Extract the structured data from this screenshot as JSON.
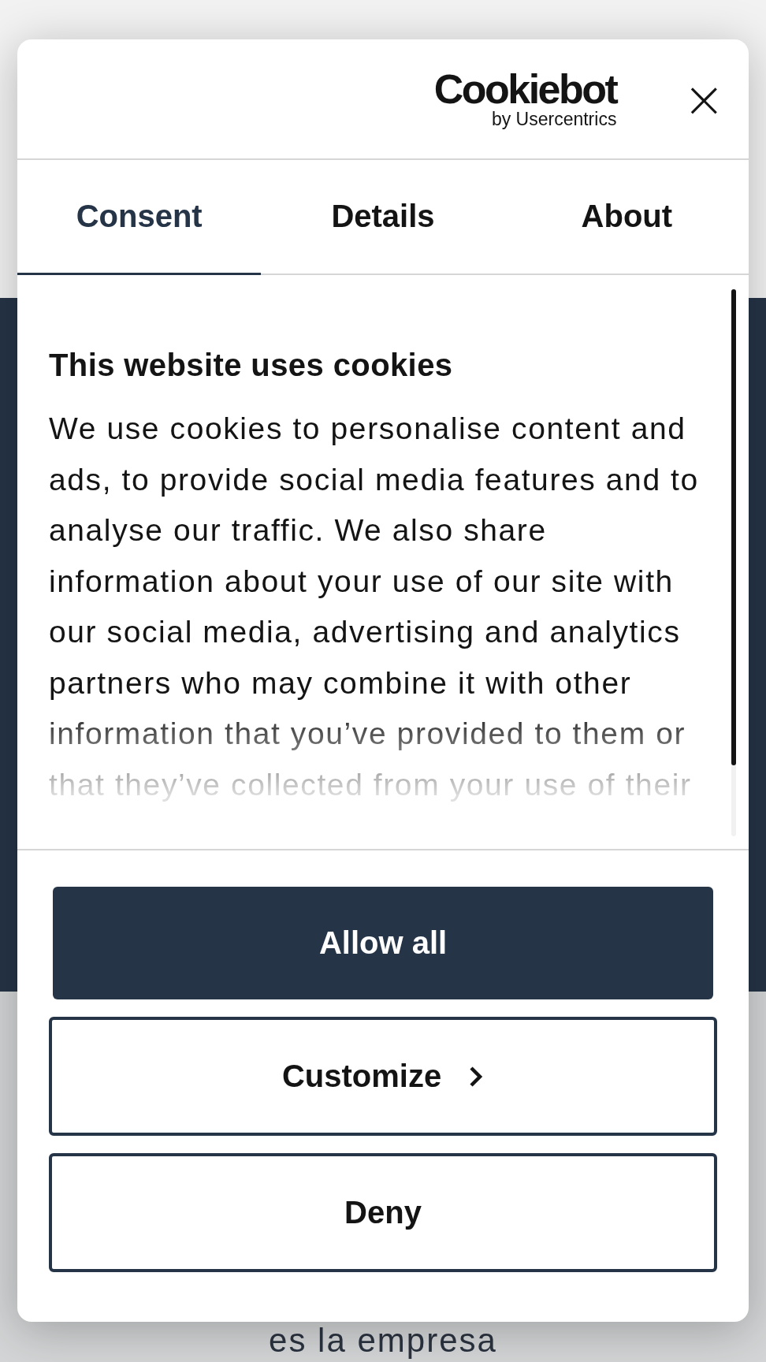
{
  "dialog": {
    "logo": {
      "name": "Cookiebot",
      "tagline": "by Usercentrics"
    },
    "close": "×",
    "tabs": [
      {
        "label": "Consent",
        "selected": true
      },
      {
        "label": "Details",
        "selected": false
      },
      {
        "label": "About",
        "selected": false
      }
    ],
    "heading": "This website uses cookies",
    "body": "We use cookies to personalise content and ads, to provide social media features and to analyse our traffic. We also share information about your use of our site with our social media, advertising and analytics partners who may combine it with other information that you’ve provided to them or that they’ve collected from your use of their",
    "buttons": [
      {
        "label": "Allow all",
        "kind": "primary"
      },
      {
        "label": "Customize",
        "kind": "chevron"
      },
      {
        "label": "Deny",
        "kind": "outline"
      }
    ]
  },
  "background": {
    "text": "es la empresa"
  }
}
